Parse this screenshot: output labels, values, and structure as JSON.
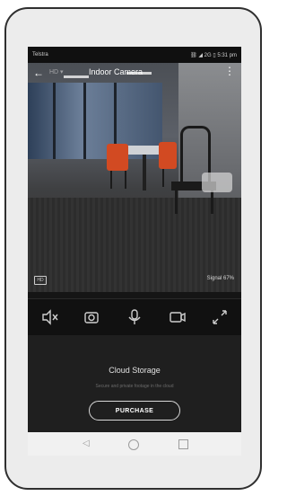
{
  "status_bar": {
    "carrier": "Telstra",
    "right": "⛓ ◢ 2G ▯ 5:31 pm"
  },
  "header": {
    "title": "Indoor Camera",
    "subtitle": "HD ▾"
  },
  "camera_overlay": {
    "left_badge": "HD",
    "signal_text": "Signal 67%"
  },
  "controls": [
    {
      "name": "speaker-mute-icon"
    },
    {
      "name": "snapshot-icon"
    },
    {
      "name": "microphone-icon"
    },
    {
      "name": "record-icon"
    },
    {
      "name": "fullscreen-icon"
    }
  ],
  "cloud_storage": {
    "title": "Cloud Storage",
    "subtitle": "Secure and private footage in the cloud",
    "purchase_label": "PURCHASE"
  },
  "nav": {
    "back": "◁"
  },
  "colors": {
    "accent_chair": "#d24a22",
    "panel_bg": "#1f1f1f",
    "screen_bg": "#151515"
  }
}
